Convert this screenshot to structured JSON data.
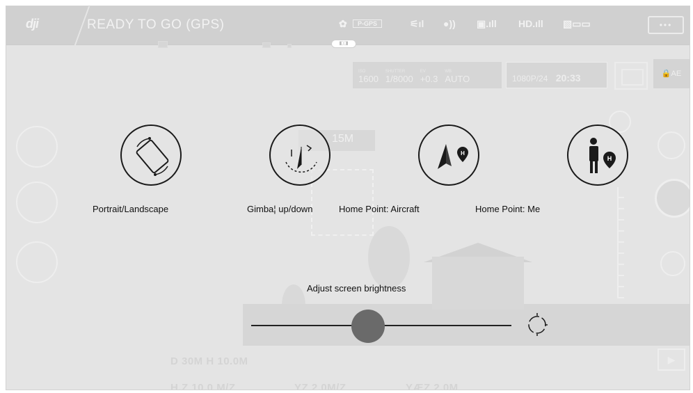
{
  "topbar": {
    "logo": "dji",
    "status": "READY TO GO (GPS)",
    "gps_label": "P-GPS",
    "hd_label": "HD",
    "menu_label": "•••",
    "indicators": [
      "satellite-icon",
      "rc-signal-icon",
      "wifi-icon",
      "battery-icon",
      "hd-signal-icon",
      "video-icon"
    ]
  },
  "camera": {
    "iso_label": "ISO",
    "iso": "1600",
    "shutter_label": "SHUTTER",
    "shutter": "1/8000",
    "ev_label": "EV",
    "ev": "+0.3",
    "wb_label": "WB",
    "wb": "AUTO",
    "resolution": "1080P/24",
    "record_time": "20:33",
    "ae_label": "AE"
  },
  "scene": {
    "altitude_box": "15M"
  },
  "telemetry": {
    "line1": "D 30M   H 10.0M",
    "line2_a": "H.Z 10.0 M/Z",
    "line2_b": "YZ 2.0M/Z",
    "line2_c": "YÆZ 2.0M"
  },
  "help": {
    "portrait": "Portrait/Landscape",
    "gimbal": "Gimba¦ up/down",
    "homepoint_aircraft": "Home Point: Aircraft",
    "homepoint_me": "Home Point: Me",
    "brightness": "Adjust screen brightness"
  },
  "brightness_slider": {
    "value": 0.45
  },
  "play_label": "▶",
  "colors": {
    "overlay_ink": "#111111",
    "ghost_ui": "#eeeeee",
    "knob": "#6a6a6a"
  }
}
